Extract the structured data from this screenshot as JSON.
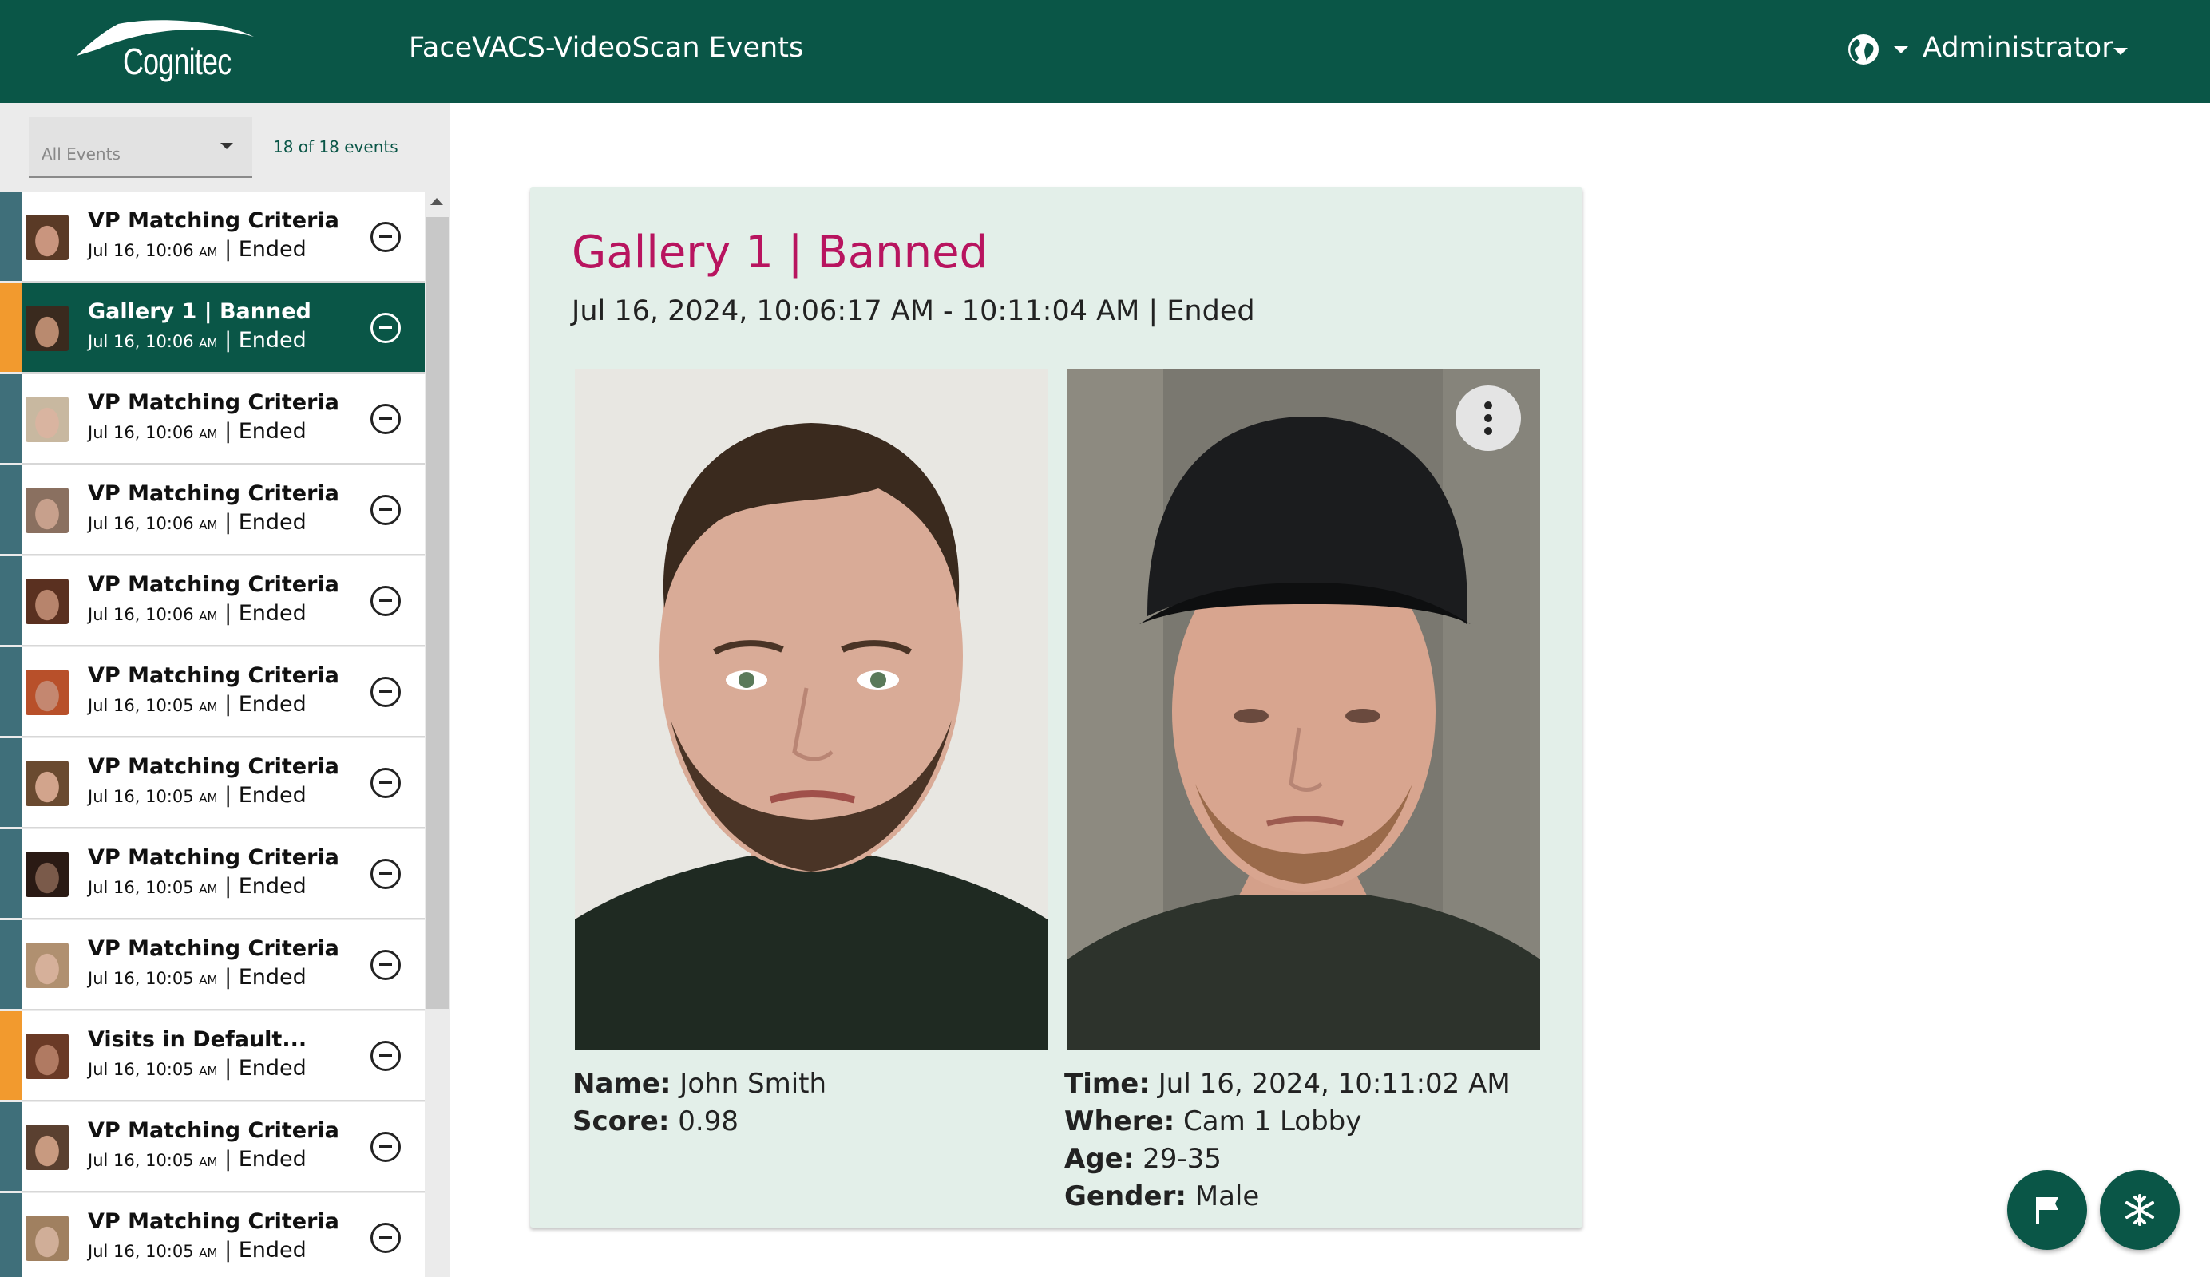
{
  "header": {
    "logo_text": "Cognitec",
    "app_title": "FaceVACS-VideoScan Events",
    "user": "Administrator",
    "icons": {
      "language": "globe-icon",
      "user_menu": "chevron-down-icon"
    }
  },
  "sidebar": {
    "filter_label": "All Events",
    "count_text": "18 of 18 events",
    "events": [
      {
        "title": "VP Matching Criteria",
        "date": "Jul 16, 10:06",
        "ampm": "AM",
        "status": "Ended",
        "stripe": "blue",
        "selected": false
      },
      {
        "title": "Gallery 1 | Banned",
        "date": "Jul 16, 10:06",
        "ampm": "AM",
        "status": "Ended",
        "stripe": "orange",
        "selected": true
      },
      {
        "title": "VP Matching Criteria",
        "date": "Jul 16, 10:06",
        "ampm": "AM",
        "status": "Ended",
        "stripe": "blue",
        "selected": false
      },
      {
        "title": "VP Matching Criteria",
        "date": "Jul 16, 10:06",
        "ampm": "AM",
        "status": "Ended",
        "stripe": "blue",
        "selected": false
      },
      {
        "title": "VP Matching Criteria",
        "date": "Jul 16, 10:06",
        "ampm": "AM",
        "status": "Ended",
        "stripe": "blue",
        "selected": false
      },
      {
        "title": "VP Matching Criteria",
        "date": "Jul 16, 10:05",
        "ampm": "AM",
        "status": "Ended",
        "stripe": "blue",
        "selected": false
      },
      {
        "title": "VP Matching Criteria",
        "date": "Jul 16, 10:05",
        "ampm": "AM",
        "status": "Ended",
        "stripe": "blue",
        "selected": false
      },
      {
        "title": "VP Matching Criteria",
        "date": "Jul 16, 10:05",
        "ampm": "AM",
        "status": "Ended",
        "stripe": "blue",
        "selected": false
      },
      {
        "title": "VP Matching Criteria",
        "date": "Jul 16, 10:05",
        "ampm": "AM",
        "status": "Ended",
        "stripe": "blue",
        "selected": false
      },
      {
        "title": "Visits in Default...",
        "date": "Jul 16, 10:05",
        "ampm": "AM",
        "status": "Ended",
        "stripe": "orange",
        "selected": false
      },
      {
        "title": "VP Matching Criteria",
        "date": "Jul 16, 10:05",
        "ampm": "AM",
        "status": "Ended",
        "stripe": "blue",
        "selected": false
      },
      {
        "title": "VP Matching Criteria",
        "date": "Jul 16, 10:05",
        "ampm": "AM",
        "status": "Ended",
        "stripe": "blue",
        "selected": false
      }
    ]
  },
  "detail": {
    "title": "Gallery 1 | Banned",
    "subtitle": "Jul 16, 2024, 10:06:17 AM - 10:11:04 AM | Ended",
    "reference": {
      "name_label": "Name:",
      "name_value": "John Smith",
      "score_label": "Score:",
      "score_value": "0.98"
    },
    "detection": {
      "time_label": "Time:",
      "time_value": "Jul 16, 2024, 10:11:02 AM",
      "where_label": "Where:",
      "where_value": "Cam 1 Lobby",
      "age_label": "Age:",
      "age_value": "29-35",
      "gender_label": "Gender:",
      "gender_value": "Male"
    },
    "icons": {
      "menu": "more-vertical-icon"
    }
  },
  "fabs": {
    "flag": "flag-icon",
    "snow": "snowflake-icon"
  },
  "colors": {
    "primary": "#0a5647",
    "accent_title": "#b8145f",
    "stripe_blue": "#3f6f7a",
    "stripe_orange": "#f29a2e",
    "card_bg": "#e3efe9"
  }
}
